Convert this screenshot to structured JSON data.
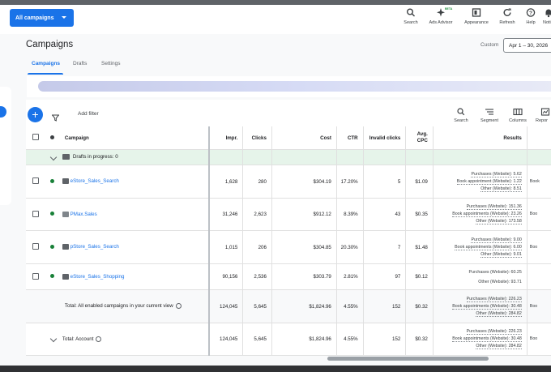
{
  "header": {
    "all_campaigns": "All campaigns",
    "tools": [
      {
        "label": "Search",
        "icon": "search-icon"
      },
      {
        "label": "Ads Advisor",
        "icon": "sparkle-icon",
        "badge": "BETA"
      },
      {
        "label": "Appearance",
        "icon": "appearance-icon"
      },
      {
        "label": "Refresh",
        "icon": "refresh-icon"
      },
      {
        "label": "Help",
        "icon": "help-icon"
      },
      {
        "label": "Noti",
        "icon": "notifications-icon"
      }
    ]
  },
  "page": {
    "title": "Campaigns",
    "tabs": [
      "Campaigns",
      "Drafts",
      "Settings"
    ],
    "date_label": "Custom",
    "date_range": "Apr 1 – 30, 2026"
  },
  "toolbar": {
    "add_filter": "Add filter",
    "tools": [
      {
        "label": "Search",
        "icon": "search-icon"
      },
      {
        "label": "Segment",
        "icon": "segment-icon"
      },
      {
        "label": "Columns",
        "icon": "columns-icon"
      },
      {
        "label": "Repor",
        "icon": "reports-icon"
      }
    ]
  },
  "table": {
    "columns": {
      "campaign": "Campaign",
      "impr": "Impr.",
      "clicks": "Clicks",
      "cost": "Cost",
      "ctr": "CTR",
      "invalid": "Invalid clicks",
      "avgcpc_1": "Avg.",
      "avgcpc_2": "CPC",
      "results": "Results"
    },
    "drafts": "Drafts in progress: 0",
    "rows": [
      {
        "name": "eStore_Sales_Search",
        "impr": "1,628",
        "clicks": "280",
        "cost": "$304.19",
        "ctr": "17.20%",
        "invalid": "5",
        "cpc": "$1.09",
        "results": [
          "Purchases (Website): 5.62",
          "Book appointment (Website): 1.22",
          "Other (Website): 8.51"
        ],
        "next": "Book"
      },
      {
        "name": "PMax.Sales",
        "impr": "31,246",
        "clicks": "2,623",
        "cost": "$912.12",
        "ctr": "8.39%",
        "invalid": "43",
        "cpc": "$0.35",
        "results": [
          "Purchases (Website): 151.36",
          "Book appointments (Website): 23.26",
          "Other (Website): 173.58"
        ],
        "next": "Boo"
      },
      {
        "name": "pStore_Sales_Search",
        "impr": "1,015",
        "clicks": "206",
        "cost": "$304.85",
        "ctr": "20.30%",
        "invalid": "7",
        "cpc": "$1.48",
        "results": [
          "Purchases (Website): 9.00",
          "Book appointments (Website): 6.00",
          "Other (Website): 9.01"
        ],
        "next": "Boo"
      },
      {
        "name": "eStore_Sales_Shopping",
        "impr": "90,156",
        "clicks": "2,536",
        "cost": "$303.79",
        "ctr": "2.81%",
        "invalid": "97",
        "cpc": "$0.12",
        "results": [
          "Purchases (Website): 60.25",
          "Other (Website): 93.71"
        ],
        "next": ""
      }
    ],
    "totals": [
      {
        "label": "Total: All enabled campaigns in your current view",
        "impr": "124,045",
        "clicks": "5,645",
        "cost": "$1,824.96",
        "ctr": "4.55%",
        "invalid": "152",
        "cpc": "$0.32",
        "results": [
          "Purchases (Website): 226.23",
          "Book appointments (Website): 30.48",
          "Other (Website): 284.82"
        ],
        "next": "Boo"
      },
      {
        "label": "Total: Account",
        "impr": "124,045",
        "clicks": "5,645",
        "cost": "$1,824.96",
        "ctr": "4.55%",
        "invalid": "152",
        "cpc": "$0.32",
        "results": [
          "Purchases (Website): 226.23",
          "Book appointments (Website): 30.48",
          "Other (Website): 284.82"
        ],
        "next": "Boo"
      }
    ]
  },
  "colors": {
    "accent": "#1a73e8",
    "enabled": "#188038",
    "draft_bg": "#e6f4ea"
  }
}
